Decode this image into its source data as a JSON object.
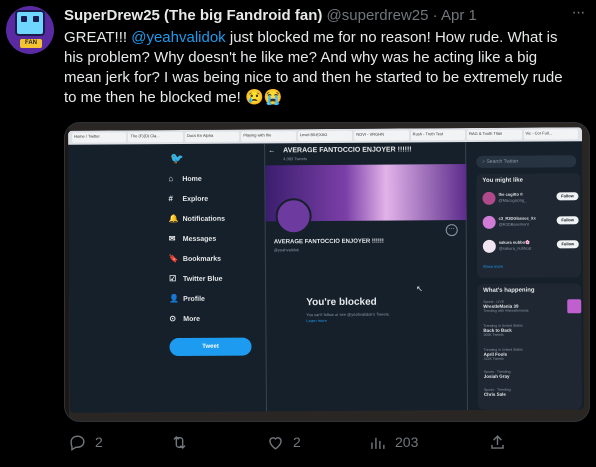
{
  "tweet": {
    "display_name": "SuperDrew25 (The big Fandroid fan)",
    "handle": "@superdrew25",
    "separator": "·",
    "date": "Apr 1",
    "avatar_badge": "FAN",
    "text_1": "GREAT!!! ",
    "mention": "@yeahvalidok",
    "text_2": " just blocked me for no reason! How rude. What is his problem? Why doesn't he like me? And why was he acting like a big mean jerk for? I was being nice to and then he started to be extremely rude to me then he blocked me! 😢😭"
  },
  "actions": {
    "replies": "2",
    "retweets": "",
    "likes": "2",
    "views": "203"
  },
  "photo": {
    "tabs": [
      "Home / Twitter",
      "The (F)(D) Cla...",
      "Docs En Alpha",
      "Playing with the",
      "Level 80-EXAG",
      "NOVI - VRGHN",
      "Rush - Truth Test",
      "RAG & Tooth Titan",
      "Vic - Cor Full..."
    ],
    "sidebar": {
      "logo": "🐦",
      "items": [
        {
          "icon": "⌂",
          "label": "Home"
        },
        {
          "icon": "#",
          "label": "Explore"
        },
        {
          "icon": "🔔",
          "label": "Notifications"
        },
        {
          "icon": "✉",
          "label": "Messages"
        },
        {
          "icon": "🔖",
          "label": "Bookmarks"
        },
        {
          "icon": "☑",
          "label": "Twitter Blue"
        },
        {
          "icon": "👤",
          "label": "Profile"
        },
        {
          "icon": "⊙",
          "label": "More"
        }
      ],
      "tweet_button": "Tweet"
    },
    "profile": {
      "header_name": "AVERAGE FANTOCCIO ENJOYER !!!!!!",
      "header_count": "4,083 Tweets",
      "name": "AVERAGE FANTOCCIO ENJOYER !!!!!!",
      "handle": "@yeahvalidok",
      "blocked_title": "You're blocked",
      "blocked_sub": "You can't follow or see @yeahvalidok's Tweets.",
      "learn_more": "Learn more"
    },
    "right": {
      "search_placeholder": "Search Twitter",
      "you_might_like": "You might like",
      "suggestions": [
        {
          "name": "the cogitto ©",
          "handle": "@Macogazing_",
          "button": "Follow"
        },
        {
          "name": "c3_R3DGlasses_Xx",
          "handle": "@R3DBasement",
          "button": "Follow"
        },
        {
          "name": "sakura nubbo🌸",
          "handle": "@sakura_nubbcat",
          "button": "Follow"
        }
      ],
      "show_more": "Show more",
      "whats_happening": "What's happening",
      "trends": [
        {
          "category": "Sports · LIVE",
          "title": "WrestleMania 39",
          "count": "Trending with #Wrestlemania"
        },
        {
          "category": "Trending in United States",
          "title": "Back to Back",
          "count": "205K Tweets"
        },
        {
          "category": "Trending in United States",
          "title": "April Fools",
          "count": "322K Tweets"
        },
        {
          "category": "Sports · Trending",
          "title": "Josiah Gray",
          "count": ""
        },
        {
          "category": "Sports · Trending",
          "title": "Chris Sale",
          "count": ""
        }
      ]
    }
  }
}
